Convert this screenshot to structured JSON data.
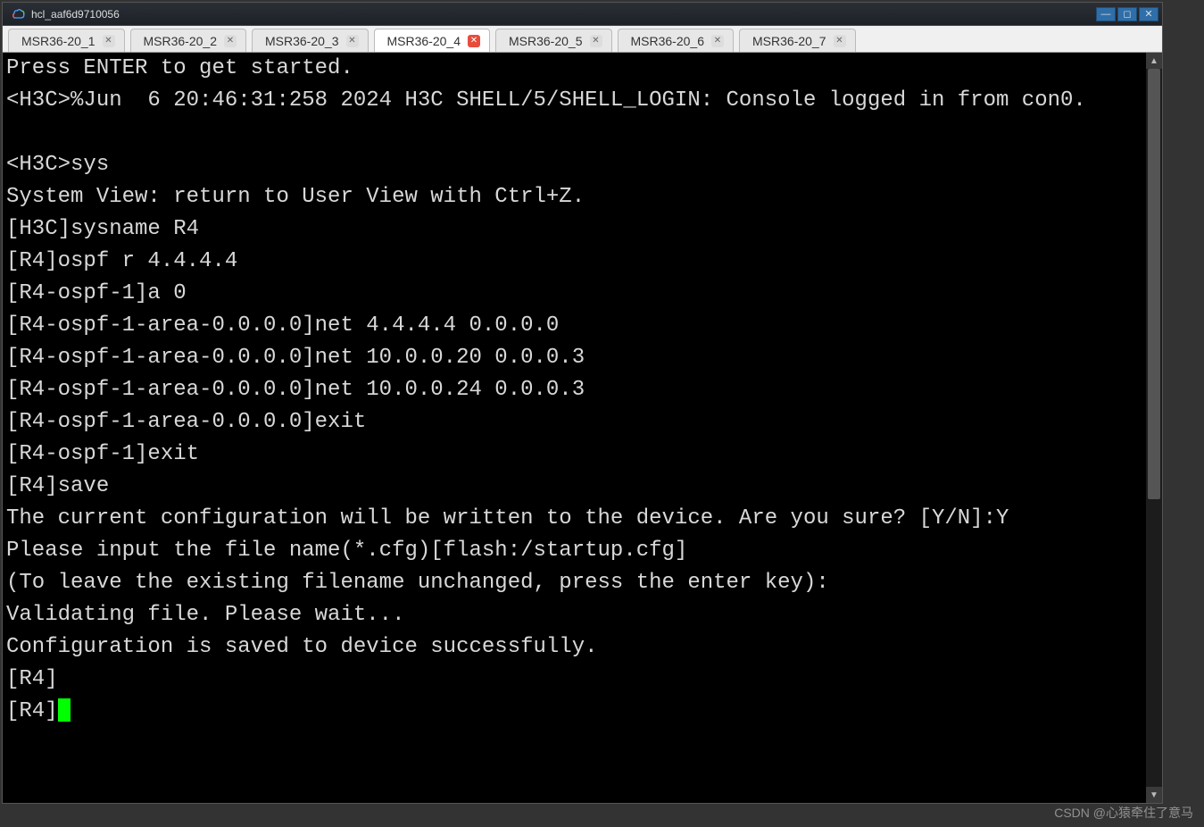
{
  "titlebar": {
    "title": "hcl_aaf6d9710056"
  },
  "tabs": [
    {
      "label": "MSR36-20_1",
      "active": false
    },
    {
      "label": "MSR36-20_2",
      "active": false
    },
    {
      "label": "MSR36-20_3",
      "active": false
    },
    {
      "label": "MSR36-20_4",
      "active": true
    },
    {
      "label": "MSR36-20_5",
      "active": false
    },
    {
      "label": "MSR36-20_6",
      "active": false
    },
    {
      "label": "MSR36-20_7",
      "active": false
    }
  ],
  "terminal": {
    "lines": [
      "Press ENTER to get started.",
      "<H3C>%Jun  6 20:46:31:258 2024 H3C SHELL/5/SHELL_LOGIN: Console logged in from con0.",
      "",
      "<H3C>sys",
      "System View: return to User View with Ctrl+Z.",
      "[H3C]sysname R4",
      "[R4]ospf r 4.4.4.4",
      "[R4-ospf-1]a 0",
      "[R4-ospf-1-area-0.0.0.0]net 4.4.4.4 0.0.0.0",
      "[R4-ospf-1-area-0.0.0.0]net 10.0.0.20 0.0.0.3",
      "[R4-ospf-1-area-0.0.0.0]net 10.0.0.24 0.0.0.3",
      "[R4-ospf-1-area-0.0.0.0]exit",
      "[R4-ospf-1]exit",
      "[R4]save",
      "The current configuration will be written to the device. Are you sure? [Y/N]:Y",
      "Please input the file name(*.cfg)[flash:/startup.cfg]",
      "(To leave the existing filename unchanged, press the enter key):",
      "Validating file. Please wait...",
      "Configuration is saved to device successfully.",
      "[R4]",
      "[R4]"
    ],
    "cursor_on_last": true
  },
  "watermark": "CSDN @心猿牵住了意马"
}
